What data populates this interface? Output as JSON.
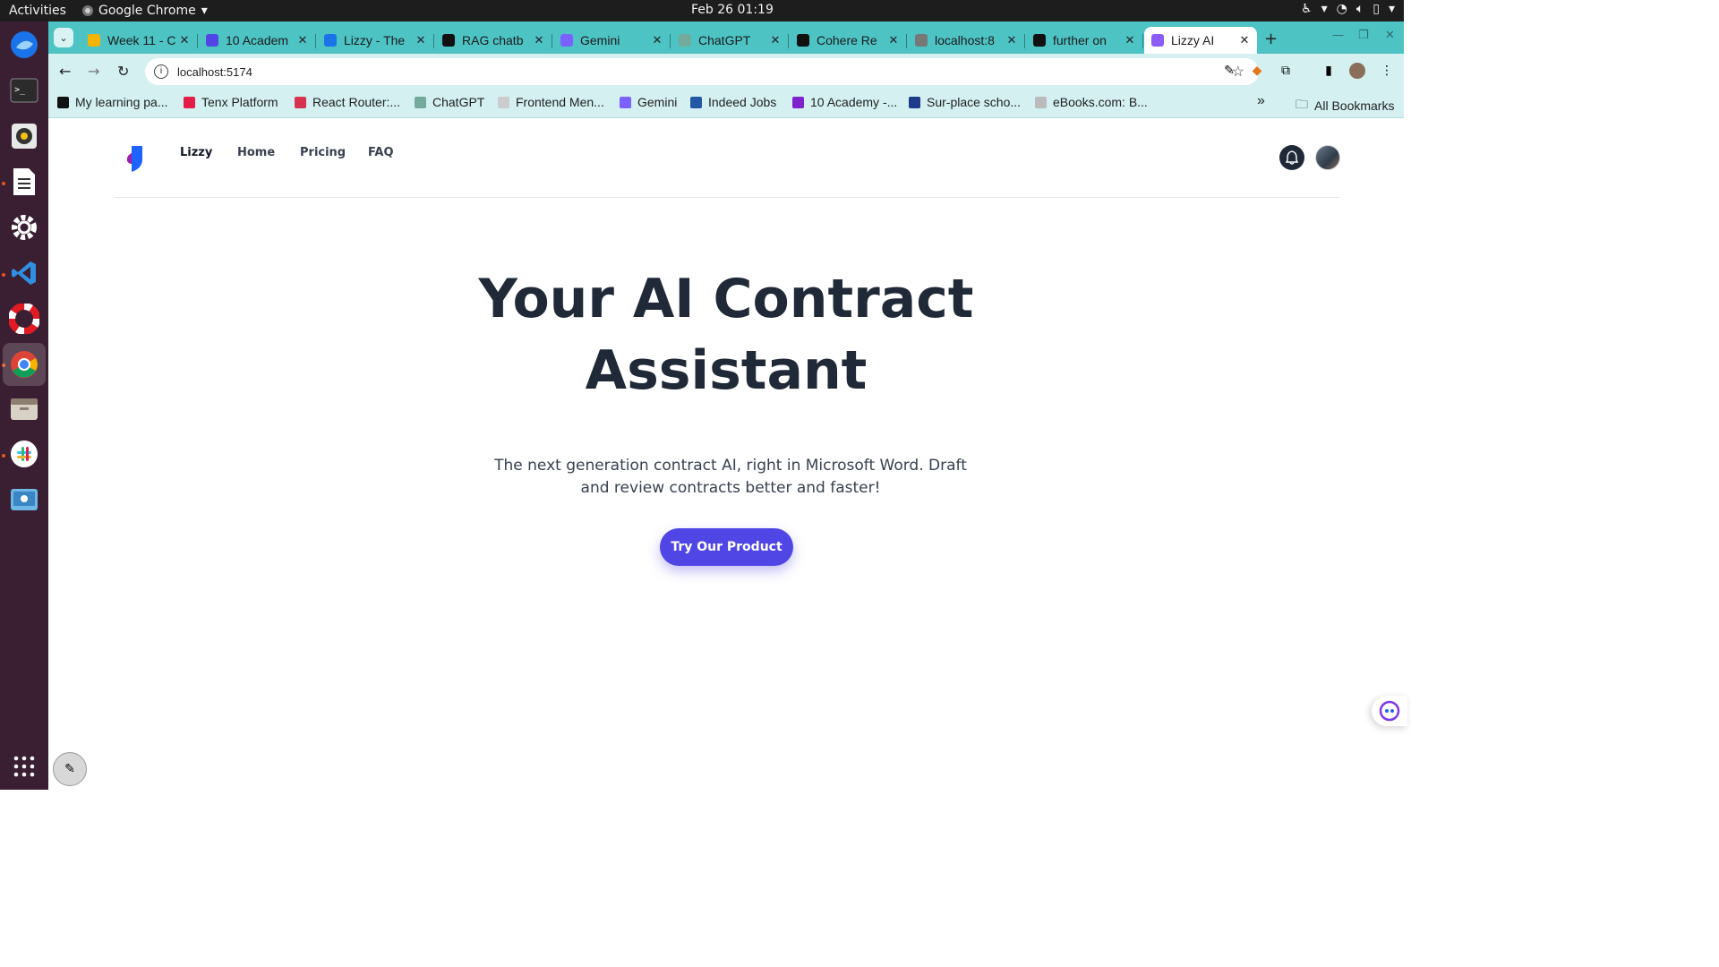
{
  "system": {
    "activities": "Activities",
    "app_name": "Google Chrome",
    "clock": "Feb 26  01:19"
  },
  "tabs": [
    {
      "title": "Week 11 - C",
      "fav_color": "#f4b400"
    },
    {
      "title": "10 Academ",
      "fav_color": "#4f46e5"
    },
    {
      "title": "Lizzy - The",
      "fav_color": "#1a73e8"
    },
    {
      "title": "RAG chatb",
      "fav_color": "#111111"
    },
    {
      "title": "Gemini",
      "fav_color": "#7b61ff"
    },
    {
      "title": "ChatGPT",
      "fav_color": "#74aa9c"
    },
    {
      "title": "Cohere Re",
      "fav_color": "#111111"
    },
    {
      "title": "localhost:8",
      "fav_color": "#777777"
    },
    {
      "title": "further on",
      "fav_color": "#111111"
    },
    {
      "title": "Lizzy AI",
      "fav_color": "#8b5cf6",
      "active": true
    }
  ],
  "address_bar": {
    "url": "localhost:5174"
  },
  "bookmarks": [
    {
      "label": "My learning pa...",
      "color": "#111111"
    },
    {
      "label": "Tenx Platform",
      "color": "#e11d48"
    },
    {
      "label": "React Router:...",
      "color": "#d6334f"
    },
    {
      "label": "ChatGPT",
      "color": "#74aa9c"
    },
    {
      "label": "Frontend Men...",
      "color": "#cccccc"
    },
    {
      "label": "Gemini",
      "color": "#7b61ff"
    },
    {
      "label": "Indeed Jobs",
      "color": "#2557a7"
    },
    {
      "label": "10 Academy -...",
      "color": "#7e22ce"
    },
    {
      "label": "Sur-place scho...",
      "color": "#1e3a8a"
    },
    {
      "label": "eBooks.com: B...",
      "color": "#bbbbbb"
    }
  ],
  "bookmarks_more": "»",
  "all_bookmarks": "All Bookmarks",
  "site": {
    "nav": {
      "brand": "Lizzy",
      "links": [
        "Home",
        "Pricing",
        "FAQ"
      ]
    },
    "hero": {
      "title_line1": "Your AI Contract",
      "title_line2": "Assistant",
      "subtitle": "The next generation contract AI, right in Microsoft Word. Draft and review contracts better and faster!",
      "cta_label": "Try Our Product"
    },
    "colors": {
      "primary": "#4f46e5",
      "heading": "#1f2937"
    }
  }
}
